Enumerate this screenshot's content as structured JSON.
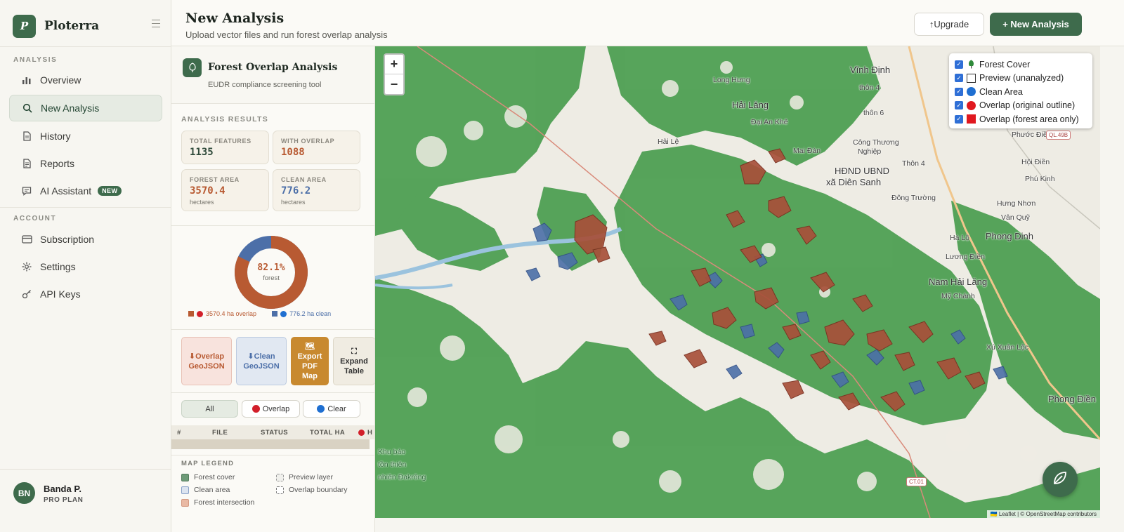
{
  "brand": {
    "logo_letter": "P",
    "name": "Ploterra"
  },
  "sidebar": {
    "section_analysis": "ANALYSIS",
    "section_account": "ACCOUNT",
    "items": [
      {
        "label": "Overview",
        "icon": "bar-chart-icon"
      },
      {
        "label": "New Analysis",
        "icon": "search-icon",
        "active": true
      },
      {
        "label": "History",
        "icon": "document-icon"
      },
      {
        "label": "Reports",
        "icon": "report-icon"
      },
      {
        "label": "AI Assistant",
        "icon": "chat-icon",
        "badge": "NEW"
      }
    ],
    "account_items": [
      {
        "label": "Subscription",
        "icon": "card-icon"
      },
      {
        "label": "Settings",
        "icon": "gear-icon"
      },
      {
        "label": "API Keys",
        "icon": "key-icon"
      }
    ],
    "user": {
      "initials": "BN",
      "name": "Banda P.",
      "plan": "PRO PLAN"
    }
  },
  "header": {
    "title": "New Analysis",
    "subtitle": "Upload vector files and run forest overlap analysis",
    "upgrade_label": "↑Upgrade",
    "new_label": "+ New Analysis"
  },
  "panel": {
    "title": "Forest Overlap Analysis",
    "subtitle": "EUDR compliance screening tool",
    "results_label": "ANALYSIS RESULTS",
    "stats": {
      "total_features": {
        "label": "TOTAL FEATURES",
        "value": "1135"
      },
      "with_overlap": {
        "label": "WITH OVERLAP",
        "value": "1088"
      },
      "forest_area": {
        "label": "FOREST AREA",
        "value": "3570.4",
        "unit": "hectares"
      },
      "clean_area": {
        "label": "CLEAN AREA",
        "value": "776.2",
        "unit": "hectares"
      }
    },
    "donut": {
      "percent_label": "82.1%",
      "sub": "forest",
      "forest_fraction": 0.821,
      "overlap_legend": "3570.4 ha overlap",
      "clean_legend": "776.2 ha clean",
      "overlap_color": "#b85a32",
      "clean_color": "#4c6fa8"
    },
    "actions": {
      "overlap_geojson": [
        "⬇Overlap",
        "GeoJSON"
      ],
      "clean_geojson": [
        "⬇Clean",
        "GeoJSON"
      ],
      "export_pdf": [
        "🗺",
        "Export",
        "PDF",
        "Map"
      ],
      "expand_table": [
        "⛶",
        "Expand",
        "Table"
      ]
    },
    "filters": {
      "all": "All",
      "overlap": "Overlap",
      "clear": "Clear"
    },
    "table_headers": {
      "num": "#",
      "file": "FILE",
      "status": "STATUS",
      "total_ha": "TOTAL HA",
      "last": "H"
    },
    "legend": {
      "title": "MAP LEGEND",
      "forest_cover": "Forest cover",
      "clean_area": "Clean area",
      "forest_intersection": "Forest intersection",
      "preview_layer": "Preview layer",
      "overlap_boundary": "Overlap boundary"
    }
  },
  "map": {
    "zoom_in": "+",
    "zoom_out": "−",
    "layers": [
      {
        "label": "Forest Cover",
        "checked": true
      },
      {
        "label": "Preview (unanalyzed)",
        "checked": true
      },
      {
        "label": "Clean Area",
        "checked": true
      },
      {
        "label": "Overlap (original outline)",
        "checked": true
      },
      {
        "label": "Overlap (forest area only)",
        "checked": true
      }
    ],
    "attribution": "🇺🇦 Leaflet | © OpenStreetMap contributors",
    "places": {
      "vinh_dinh": "Vĩnh Định",
      "long_hung": "Long Hưng",
      "hai_lang": "Hải Lăng",
      "dai_an_khe": "Đại An Khê",
      "hai_le": "Hải Lệ",
      "mai_dan": "Mai Đàn",
      "cong_thuong": "Công Thương",
      "nghiep": "Nghiệp",
      "hdnd": "HĐND UBND",
      "dien_sanh": "xã Diên Sanh",
      "thon4a": "thôn 4",
      "thon6": "thôn 6",
      "thon4b": "Thôn 4",
      "phuoc_dien": "Phước Điền",
      "hoi_dien": "Hội Điền",
      "phu_kinh": "Phú Kinh",
      "dong_truong": "Đông Trường",
      "hung_nhon": "Hưng Nhơn",
      "van_quy": "Vân Quỹ",
      "ha_lo": "Hà Lộ",
      "phong_dinh": "Phong Dinh",
      "luong_dien": "Lương Điền",
      "nam_hai_lang": "Nam Hải Lăng",
      "my_chanh": "Mỹ Chánh",
      "phong_dien": "Phong Điền",
      "xu_xuan_loc": "Xú Xuân Lộc",
      "khu_bao": "Khu bảo",
      "ton_thien": "tồn thiên",
      "dakrong": "nhiên Đakrông",
      "ql49b": "QL.49B",
      "ct01": "CT.01"
    }
  }
}
